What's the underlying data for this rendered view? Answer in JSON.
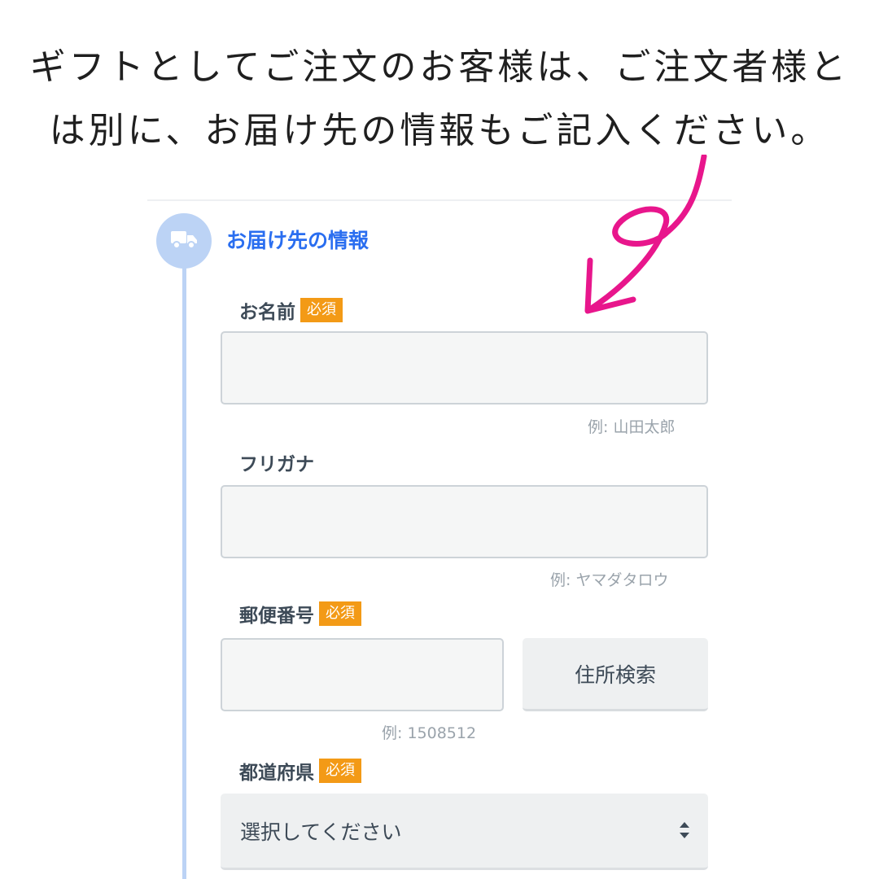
{
  "caption": {
    "line1": "ギフトとしてご注文のお客様は、ご注文者様と",
    "line2": "は別に、お届け先の情報もご記入ください。"
  },
  "section": {
    "title": "お届け先の情報",
    "icon": "truck-icon"
  },
  "form": {
    "name": {
      "label": "お名前",
      "required_badge": "必須",
      "value": "",
      "hint": "例: 山田太郎"
    },
    "furigana": {
      "label": "フリガナ",
      "value": "",
      "hint": "例: ヤマダタロウ"
    },
    "postal_code": {
      "label": "郵便番号",
      "required_badge": "必須",
      "value": "",
      "hint": "例: 1508512",
      "search_button": "住所検索"
    },
    "prefecture": {
      "label": "都道府県",
      "required_badge": "必須",
      "selected": "選択してください"
    }
  },
  "colors": {
    "accent": "#2a6ef0",
    "timeline": "#bcd3f5",
    "badge": "#f39a16",
    "annotation_arrow": "#e8168c"
  }
}
